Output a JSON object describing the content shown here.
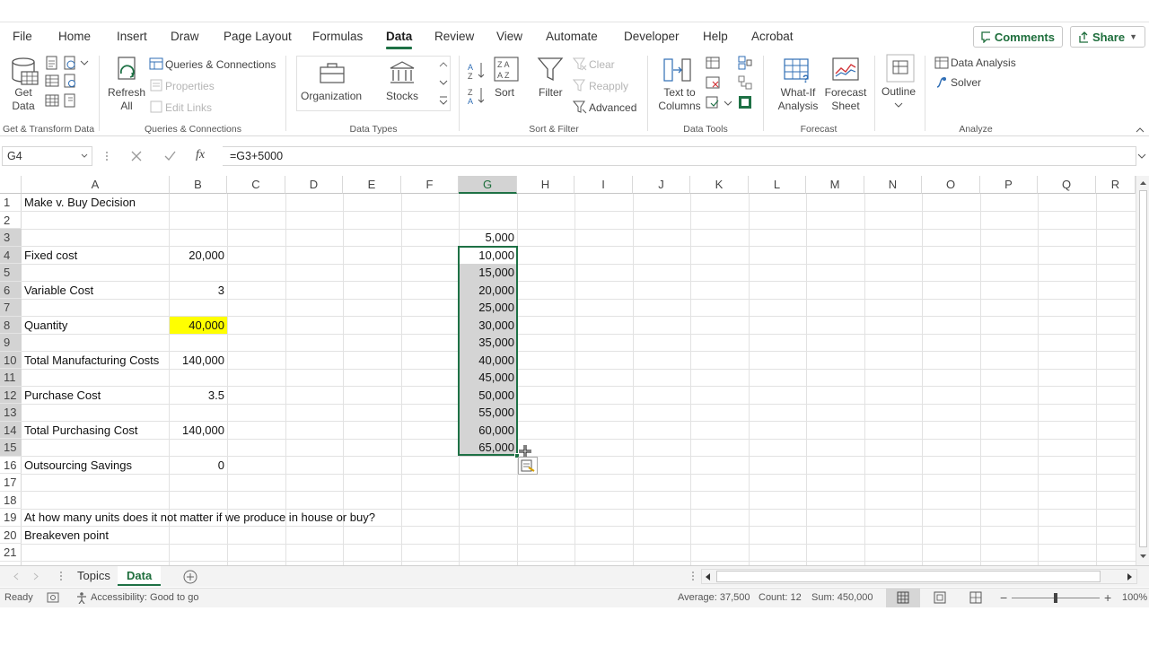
{
  "menu": {
    "tabs": [
      "File",
      "Home",
      "Insert",
      "Draw",
      "Page Layout",
      "Formulas",
      "Data",
      "Review",
      "View",
      "Automate",
      "Developer",
      "Help",
      "Acrobat"
    ],
    "active_tab": "Data",
    "comments_label": "Comments",
    "share_label": "Share"
  },
  "ribbon": {
    "get_data": "Get\nData",
    "refresh_all": "Refresh\nAll",
    "queries_connections": "Queries & Connections",
    "properties": "Properties",
    "edit_links": "Edit Links",
    "organization": "Organization",
    "stocks": "Stocks",
    "sort": "Sort",
    "filter": "Filter",
    "clear": "Clear",
    "reapply": "Reapply",
    "advanced": "Advanced",
    "text_to_columns": "Text to\nColumns",
    "what_if": "What-If\nAnalysis",
    "forecast_sheet": "Forecast\nSheet",
    "outline": "Outline",
    "data_analysis": "Data Analysis",
    "solver": "Solver",
    "groups": {
      "get_transform": "Get & Transform Data",
      "queries": "Queries & Connections",
      "data_types": "Data Types",
      "sort_filter": "Sort & Filter",
      "data_tools": "Data Tools",
      "forecast": "Forecast",
      "analyze": "Analyze"
    }
  },
  "formula_bar": {
    "name_box": "G4",
    "formula": "=G3+5000"
  },
  "grid": {
    "columns": [
      "A",
      "B",
      "C",
      "D",
      "E",
      "F",
      "G",
      "H",
      "I",
      "J",
      "K",
      "L",
      "M",
      "N",
      "O",
      "P",
      "Q",
      "R"
    ],
    "selected_column": "G",
    "rows": [
      "1",
      "2",
      "3",
      "4",
      "5",
      "6",
      "7",
      "8",
      "9",
      "10",
      "11",
      "12",
      "13",
      "14",
      "15",
      "16",
      "17",
      "18",
      "19",
      "20",
      "21"
    ],
    "cells_a": {
      "1": "Make v. Buy Decision",
      "4": "Fixed cost",
      "6": "Variable Cost",
      "8": "Quantity",
      "10": "Total Manufacturing Costs",
      "12": "Purchase Cost",
      "14": "Total Purchasing Cost",
      "16": "Outsourcing Savings",
      "19": "At how many units does it not matter if we produce in house or buy?",
      "20": "Breakeven point"
    },
    "cells_b": {
      "4": "20,000",
      "6": "3",
      "8": "40,000",
      "10": "140,000",
      "12": "3.5",
      "14": "140,000",
      "16": "0"
    },
    "highlight_color": "#ffff00",
    "cells_g": {
      "3": "5,000",
      "4": "10,000",
      "5": "15,000",
      "6": "20,000",
      "7": "25,000",
      "8": "30,000",
      "9": "35,000",
      "10": "40,000",
      "11": "45,000",
      "12": "50,000",
      "13": "55,000",
      "14": "60,000",
      "15": "65,000"
    }
  },
  "sheets": {
    "tabs": [
      "Topics",
      "Data"
    ],
    "active": "Data"
  },
  "status": {
    "ready": "Ready",
    "accessibility": "Accessibility: Good to go",
    "average": "Average: 37,500",
    "count": "Count: 12",
    "sum": "Sum: 450,000",
    "zoom": "100%"
  },
  "accent_color": "#1e7145"
}
